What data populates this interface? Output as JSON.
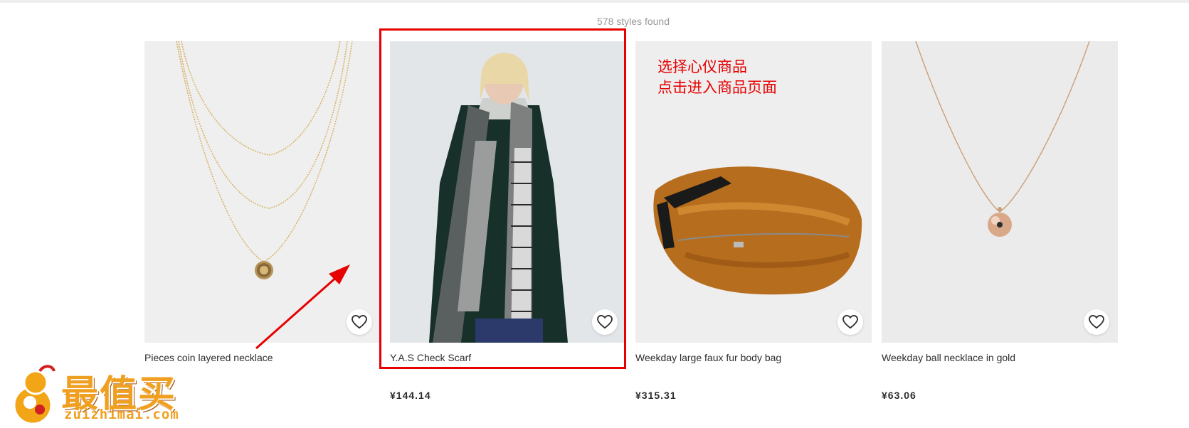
{
  "results": {
    "count_text": "578 styles found"
  },
  "products": [
    {
      "name": "Pieces coin layered necklace",
      "price": ""
    },
    {
      "name": "Y.A.S Check Scarf",
      "price": "¥144.14"
    },
    {
      "name": "Weekday large faux fur body bag",
      "price": "¥315.31"
    },
    {
      "name": "Weekday ball necklace in gold",
      "price": "¥63.06"
    }
  ],
  "annotation": {
    "line1": "选择心仪商品",
    "line2": "点击进入商品页面",
    "color": "#e60000"
  },
  "watermark": {
    "brand_cn": "最值买",
    "brand_en": "zuizhimai.com",
    "icon": "gourd-mascot-icon",
    "color": "#f0a020"
  },
  "icons": {
    "favorite": "heart-icon"
  }
}
